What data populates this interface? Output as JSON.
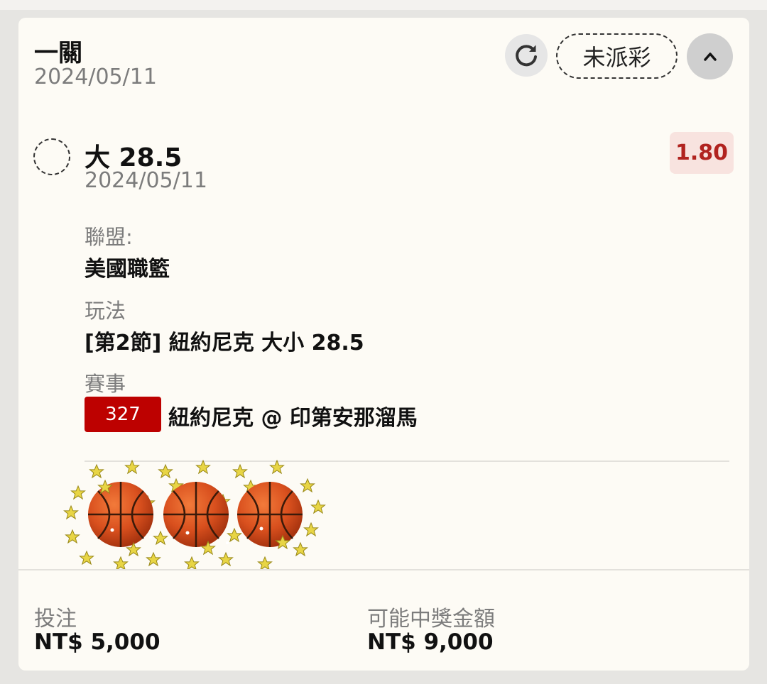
{
  "header": {
    "title": "一關",
    "date": "2024/05/11",
    "status": "未派彩",
    "refresh_icon": "refresh-icon",
    "collapse_icon": "chevron-up-icon"
  },
  "selection": {
    "name": "大 28.5",
    "date": "2024/05/11",
    "odds": "1.80"
  },
  "details": {
    "league_label": "聯盟:",
    "league_value": "美國職籃",
    "bet_type_label": "玩法",
    "bet_type_value": "[第2節] 紐約尼克 大小 28.5",
    "event_label": "賽事",
    "event_id": "327",
    "event_name": "紐約尼克 @ 印第安那溜馬"
  },
  "footer": {
    "stake_label": "投注",
    "stake_value": "NT$ 5,000",
    "payout_label": "可能中獎金額",
    "payout_value": "NT$ 9,000"
  },
  "colors": {
    "card_bg": "#fdfbf5",
    "odds_text": "#b1231f",
    "odds_bg": "#f8e3df",
    "event_badge": "#bd0100",
    "muted_text": "#7c7c7c"
  }
}
